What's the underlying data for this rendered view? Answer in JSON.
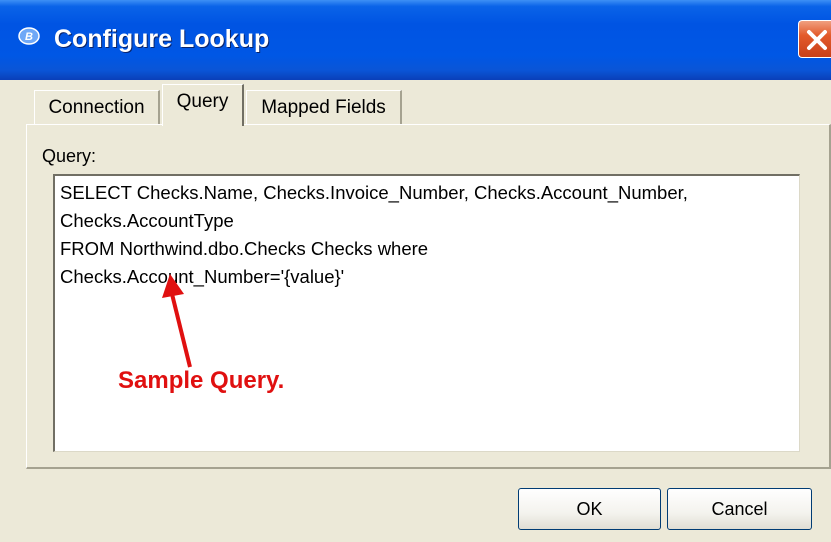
{
  "window": {
    "title": "Configure Lookup",
    "app_icon": "app-logo-icon",
    "close_icon": "close-icon"
  },
  "tabs": [
    {
      "label": "Connection",
      "selected": false
    },
    {
      "label": "Query",
      "selected": true
    },
    {
      "label": "Mapped Fields",
      "selected": false
    }
  ],
  "query": {
    "label": "Query:",
    "value": "SELECT Checks.Name, Checks.Invoice_Number, Checks.Account_Number,\nChecks.AccountType\nFROM Northwind.dbo.Checks Checks where\nChecks.Account_Number='{value}'"
  },
  "annotation": {
    "text": "Sample Query.",
    "color": "#e01010"
  },
  "buttons": {
    "ok": "OK",
    "cancel": "Cancel"
  },
  "colors": {
    "titlebar": "#0054e3",
    "dialog_bg": "#ece9d8",
    "close_button": "#e35a2a"
  }
}
